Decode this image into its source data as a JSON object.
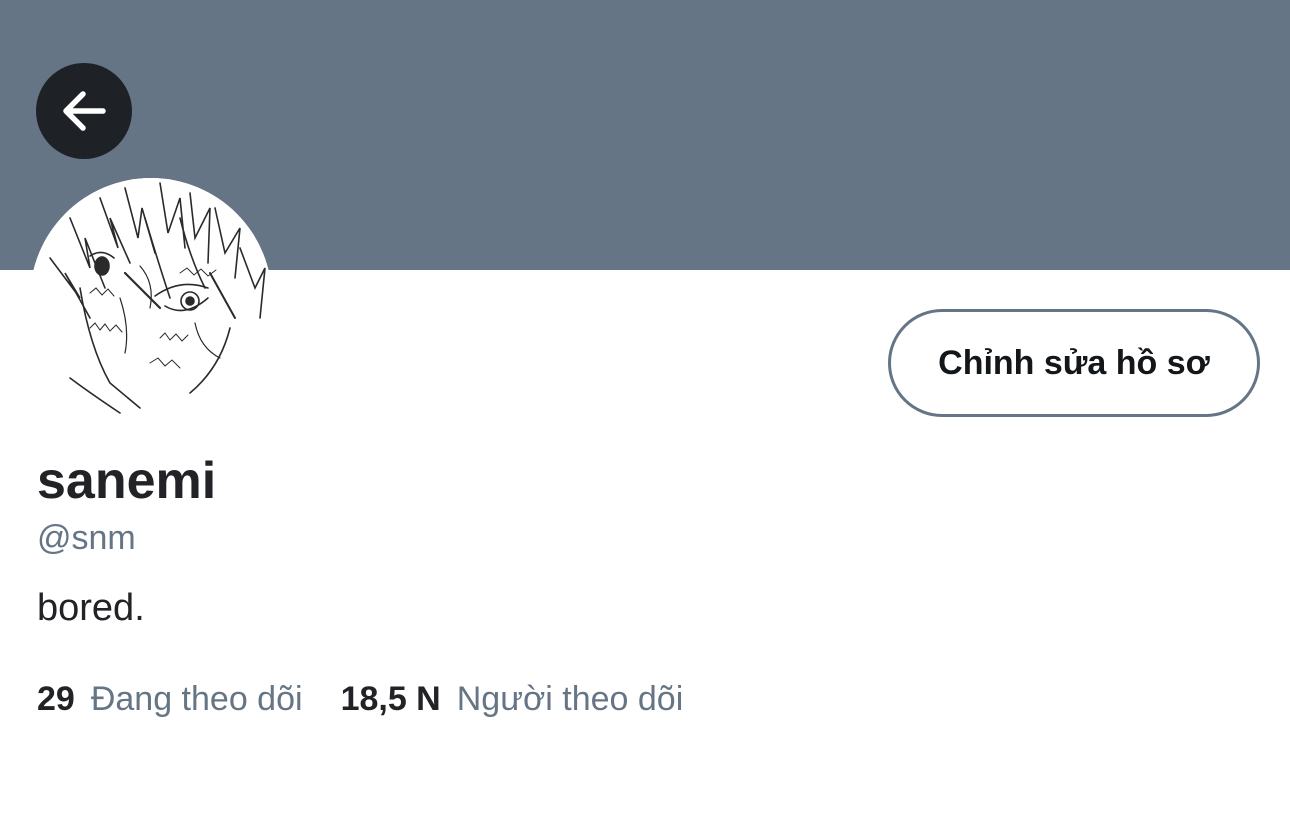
{
  "header": {
    "back_icon": "arrow-left-icon",
    "banner_color": "#657586"
  },
  "profile": {
    "avatar": "manga-style-avatar",
    "edit_button_label": "Chỉnh sửa hồ sơ",
    "display_name": "sanemi",
    "handle": "@snm",
    "bio": "bored."
  },
  "stats": {
    "following_count": "29",
    "following_label": "Đang theo dõi",
    "followers_count": "18,5 N",
    "followers_label": "Người theo dõi"
  },
  "colors": {
    "text_primary": "#222326",
    "text_secondary": "#657586",
    "back_button_bg": "#1e2226"
  }
}
